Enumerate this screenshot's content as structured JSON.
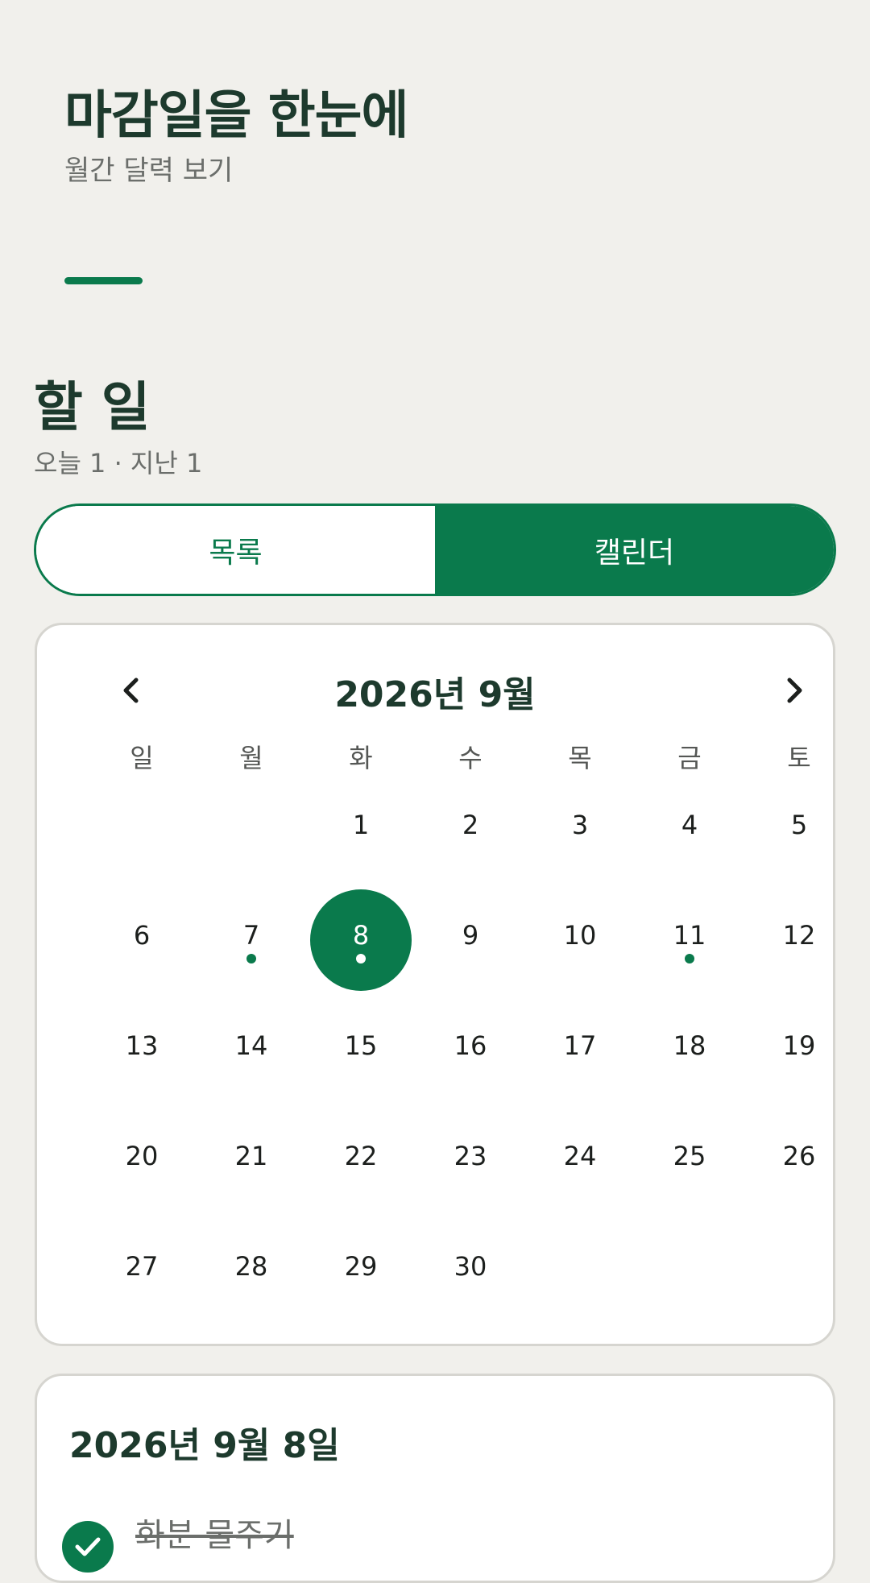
{
  "header": {
    "title": "마감일을 한눈에",
    "subtitle": "월간 달력 보기"
  },
  "section": {
    "title": "할 일",
    "meta": "오늘 1 · 지난 1"
  },
  "view_toggle": {
    "options": [
      "목록",
      "캘린더"
    ],
    "selected": "캘린더"
  },
  "calendar": {
    "month_label": "2026년 9월",
    "weekdays": [
      "일",
      "월",
      "화",
      "수",
      "목",
      "금",
      "토"
    ],
    "leading_blanks": 2,
    "days": [
      "1",
      "2",
      "3",
      "4",
      "5",
      "6",
      "7",
      "8",
      "9",
      "10",
      "11",
      "12",
      "13",
      "14",
      "15",
      "16",
      "17",
      "18",
      "19",
      "20",
      "21",
      "22",
      "23",
      "24",
      "25",
      "26",
      "27",
      "28",
      "29",
      "30"
    ],
    "selected_day": "8",
    "days_with_tasks": [
      "7",
      "8",
      "11"
    ]
  },
  "detail": {
    "date_label": "2026년 9월 8일",
    "tasks": [
      {
        "label": "화분 물주기",
        "done": true
      }
    ]
  },
  "colors": {
    "accent": "#0a7a4c",
    "background": "#f1f0ec",
    "card": "#ffffff",
    "heading": "#1d3a2d",
    "muted": "#6b6e6b"
  },
  "icons": {
    "prev": "chevron-left-icon",
    "next": "chevron-right-icon",
    "task_done": "check-icon"
  }
}
